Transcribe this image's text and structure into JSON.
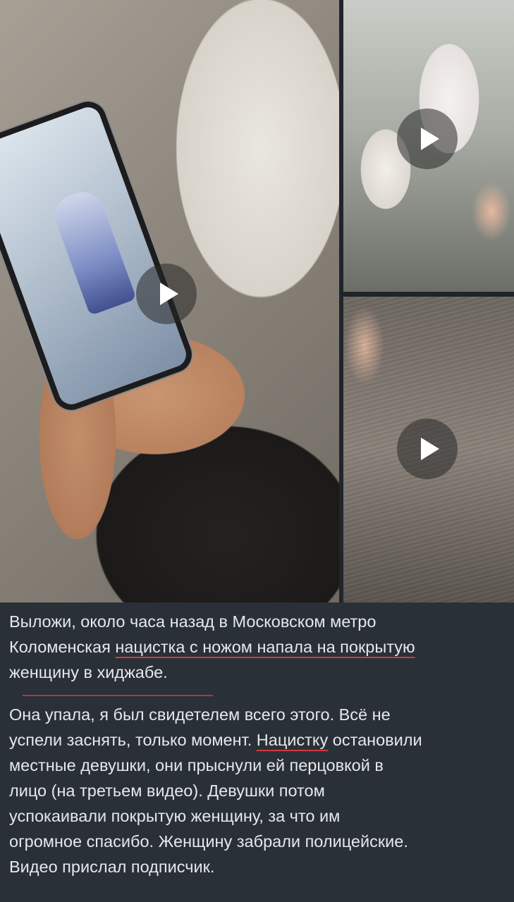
{
  "media": {
    "items": [
      {
        "type": "video",
        "play_icon": "play-icon"
      },
      {
        "type": "video",
        "play_icon": "play-icon"
      },
      {
        "type": "video",
        "play_icon": "play-icon"
      }
    ]
  },
  "caption": {
    "paragraph1": {
      "line1": "Выложи, около часа назад в Московском метро",
      "line2_pre": "Коломенская ",
      "line2_underlined": "нацистка с ножом напала на покрытую",
      "line3": "женщину в хиджабе."
    },
    "paragraph2": {
      "line1": "Она упала, я был свидетелем всего этого. Всё не",
      "line2_pre": "успели заснять, только момент. ",
      "line2_underlined": "Нацистку",
      "line2_post": " остановили",
      "line3": "местные девушки, они прыснули ей перцовкой в",
      "line4": "лицо (на третьем видео). Девушки потом",
      "line5": "успокаивали покрытую женщину, за что им",
      "line6": "огромное спасибо. Женщину забрали полицейские.",
      "line7": "Видео прислал подписчик."
    }
  },
  "colors": {
    "background": "#2a3038",
    "text": "#e6e8ea",
    "annotation_red": "#d23a3a"
  }
}
